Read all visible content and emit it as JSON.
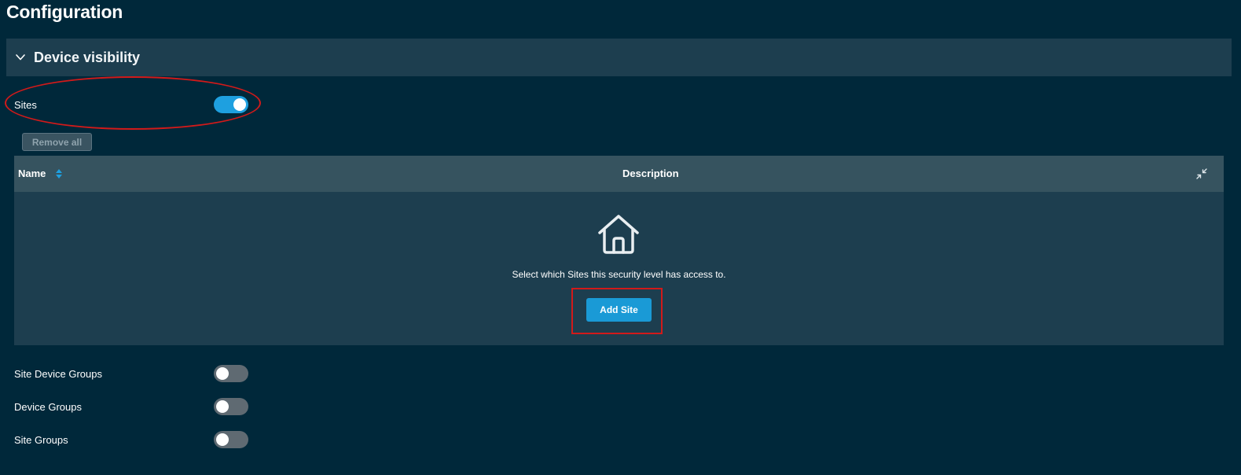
{
  "page": {
    "title": "Configuration"
  },
  "section": {
    "title": "Device visibility",
    "expanded": true
  },
  "sites_toggle": {
    "label": "Sites",
    "on": true
  },
  "remove_all_label": "Remove all",
  "table": {
    "columns": [
      "Name",
      "Description"
    ],
    "sorted_column": "Name"
  },
  "empty_state": {
    "icon": "home-icon",
    "message": "Select which Sites this security level has access to.",
    "button_label": "Add Site"
  },
  "other_toggles": [
    {
      "label": "Site Device Groups",
      "on": false
    },
    {
      "label": "Device Groups",
      "on": false
    },
    {
      "label": "Site Groups",
      "on": false
    }
  ],
  "colors": {
    "background": "#00283a",
    "accent": "#1a9ad6",
    "annotation": "#d11a1a"
  }
}
